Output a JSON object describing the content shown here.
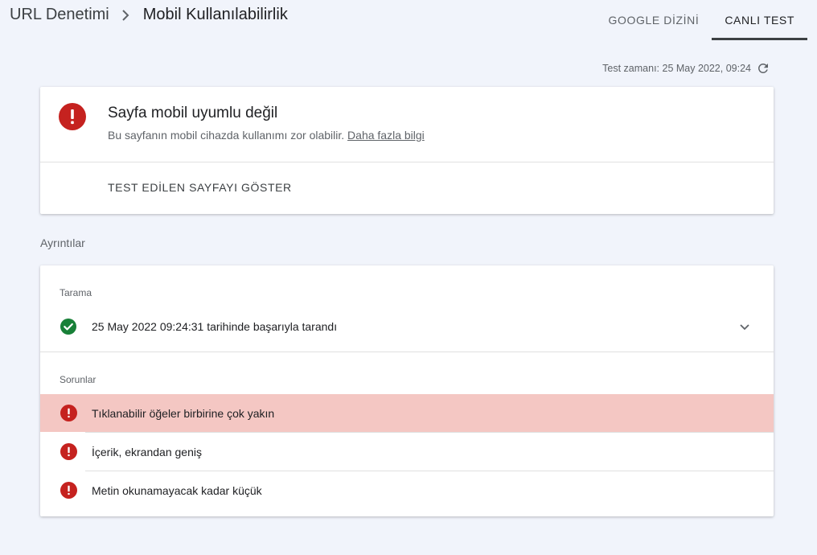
{
  "breadcrumb": {
    "parent": "URL Denetimi",
    "current": "Mobil Kullanılabilirlik"
  },
  "tabs": [
    {
      "label": "GOOGLE DİZİNİ",
      "active": false
    },
    {
      "label": "CANLI TEST",
      "active": true
    }
  ],
  "test_time": "Test zamanı: 25 May 2022, 09:24",
  "result_card": {
    "title": "Sayfa mobil uyumlu değil",
    "description": "Bu sayfanın mobil cihazda kullanımı zor olabilir.",
    "link": "Daha fazla bilgi",
    "button": "TEST EDİLEN SAYFAYI GÖSTER"
  },
  "details_label": "Ayrıntılar",
  "crawl": {
    "label": "Tarama",
    "text": "25 May 2022 09:24:31 tarihinde başarıyla tarandı"
  },
  "issues": {
    "label": "Sorunlar",
    "items": [
      "Tıklanabilir öğeler birbirine çok yakın",
      "İçerik, ekrandan geniş",
      "Metin okunamayacak kadar küçük"
    ]
  },
  "colors": {
    "error": "#c5221f",
    "success": "#188038",
    "selected_row": "#f4c7c3",
    "background": "#f1f4fb"
  }
}
